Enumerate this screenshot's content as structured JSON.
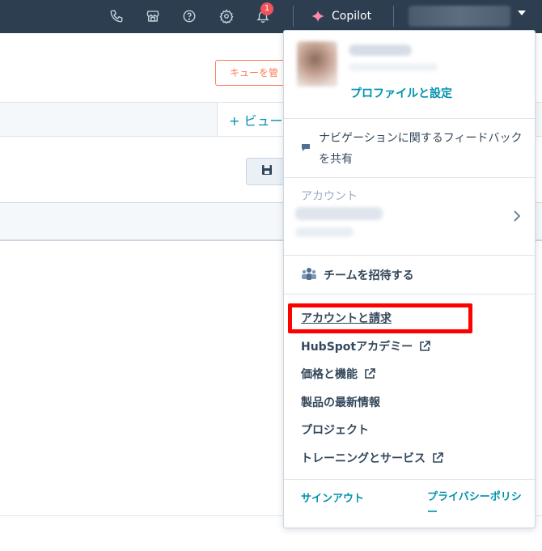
{
  "topbar": {
    "icons": [
      "phone-icon",
      "marketplace-icon",
      "help-icon",
      "settings-icon",
      "bell-icon"
    ],
    "notification_count": "1",
    "copilot_label": "Copilot",
    "background_color": "#2d3e50"
  },
  "background_page": {
    "queue_button_label": "キューを管",
    "add_view_label": "+ ビュー",
    "save_icon": "save-icon",
    "accent_color": "#ff7a59"
  },
  "account_menu": {
    "profile_link": "プロファイルと設定",
    "feedback_text": "ナビゲーションに関するフィードバックを共有",
    "account_section_label": "アカウント",
    "invite_team": "チームを招待する",
    "items": [
      {
        "label": "アカウントと請求",
        "external": false
      },
      {
        "label": "HubSpotアカデミー",
        "external": true
      },
      {
        "label": "価格と機能",
        "external": true
      },
      {
        "label": "製品の最新情報",
        "external": false
      },
      {
        "label": "プロジェクト",
        "external": false
      },
      {
        "label": "トレーニングとサービス",
        "external": true
      }
    ],
    "sign_out": "サインアウト",
    "privacy_policy": "プライバシーポリシー",
    "link_color": "#0091ae",
    "highlight_color": "#ff0000"
  }
}
